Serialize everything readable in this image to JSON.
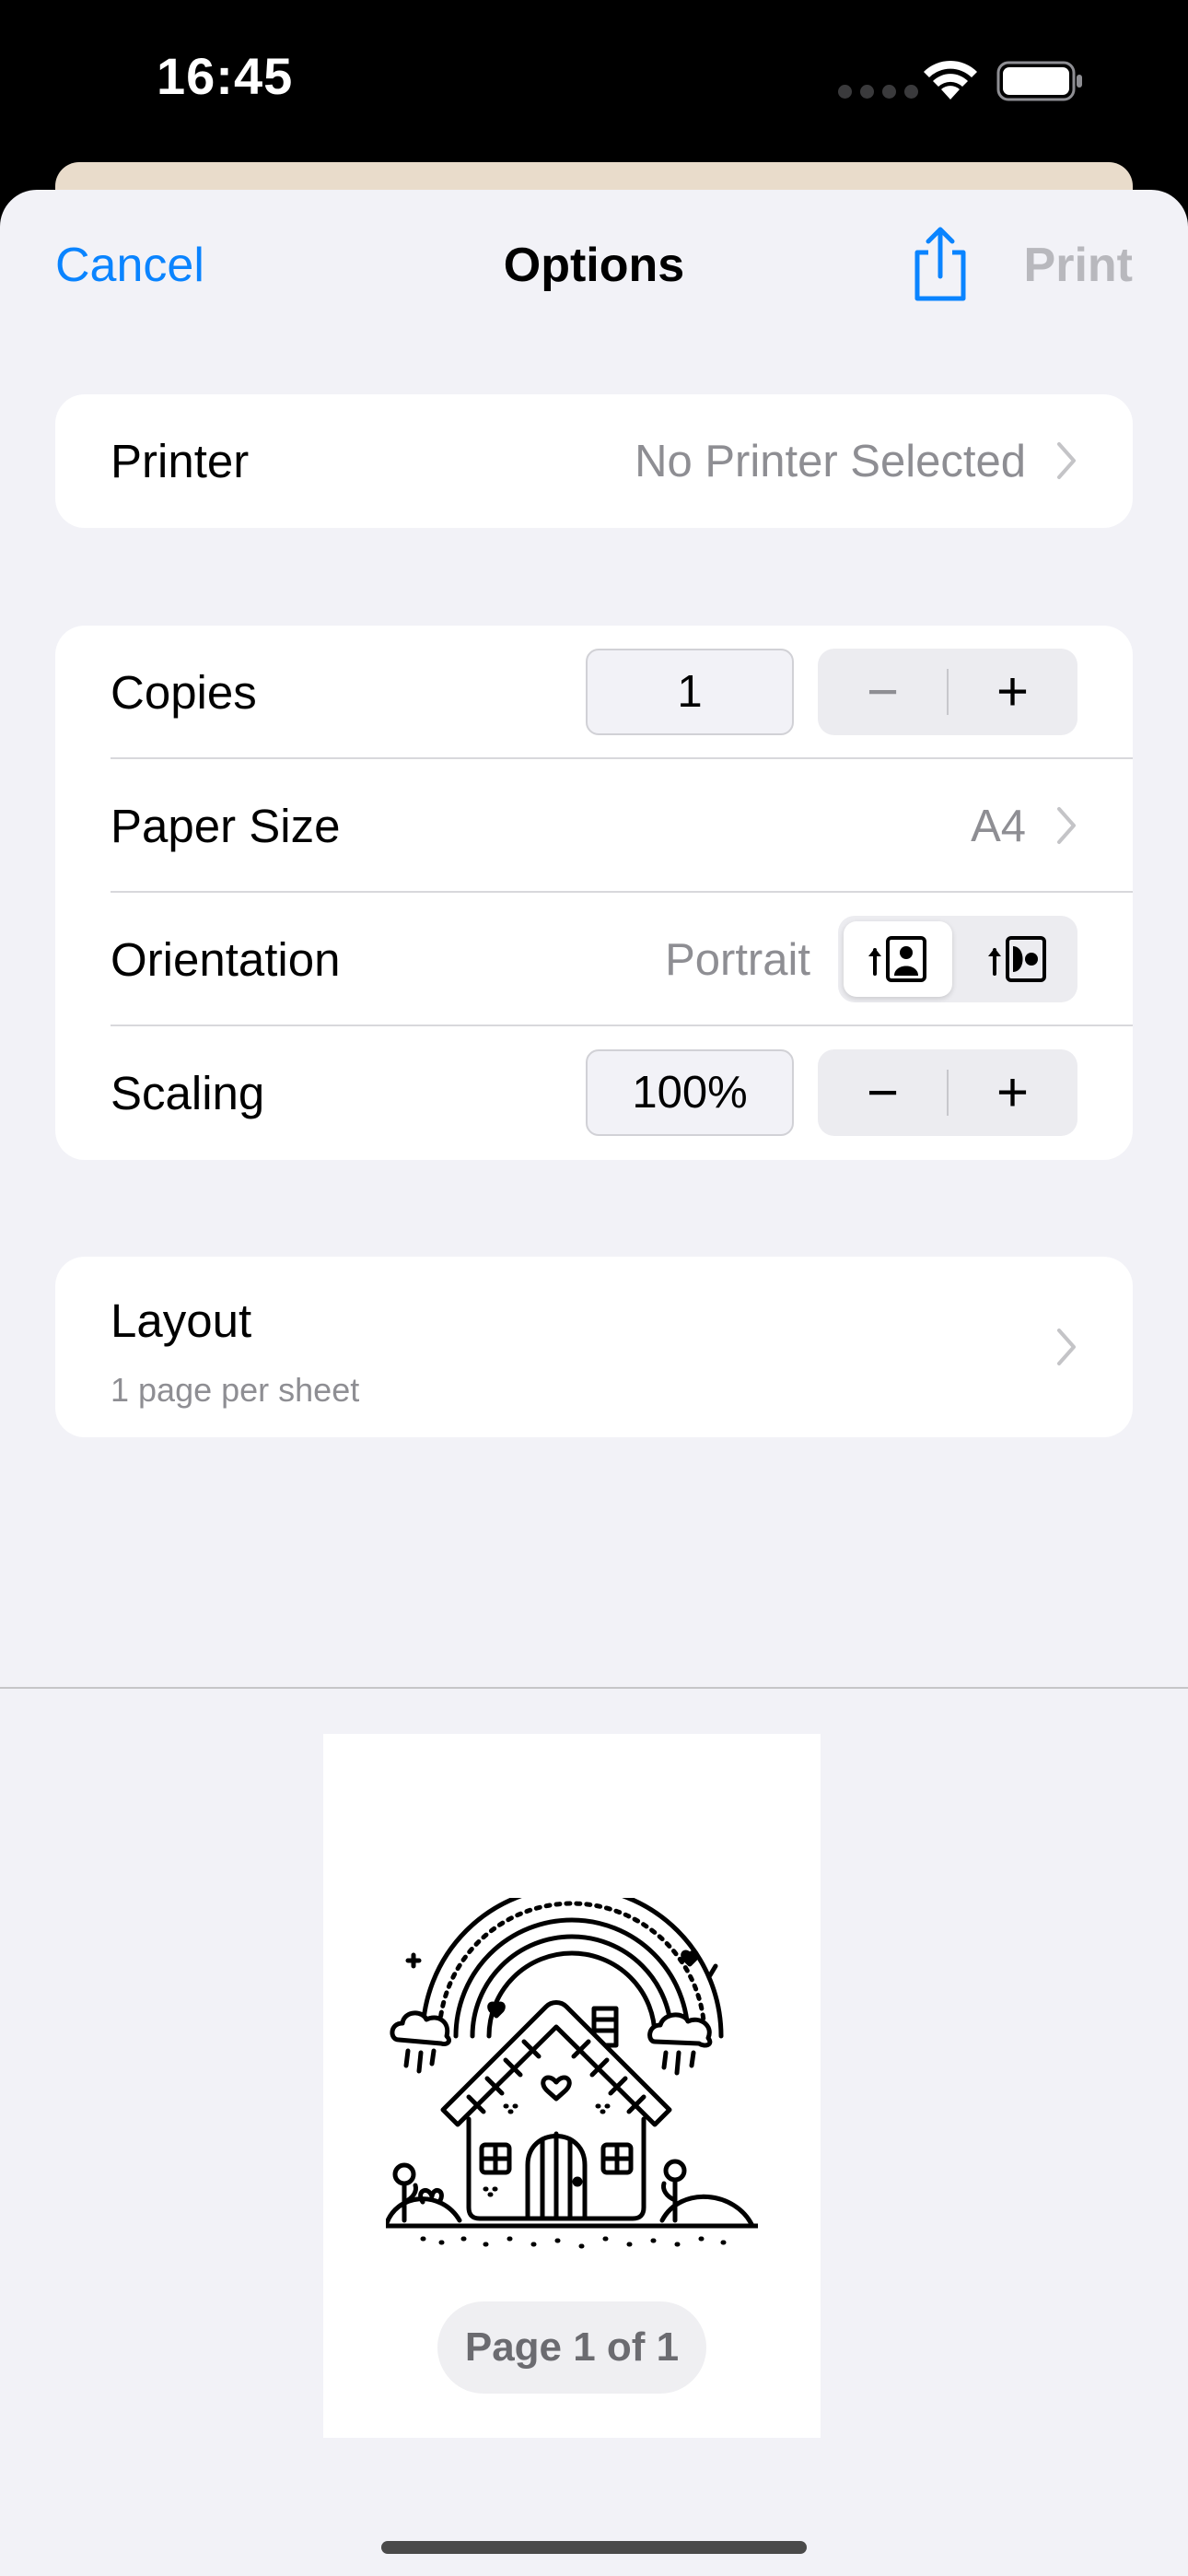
{
  "status_bar": {
    "time": "16:45"
  },
  "nav": {
    "cancel_label": "Cancel",
    "title": "Options",
    "print_label": "Print",
    "share_icon": "share-icon"
  },
  "printer": {
    "label": "Printer",
    "value": "No Printer Selected"
  },
  "copies": {
    "label": "Copies",
    "value": "1",
    "minus": "−",
    "plus": "+"
  },
  "paper_size": {
    "label": "Paper Size",
    "value": "A4"
  },
  "orientation": {
    "label": "Orientation",
    "value": "Portrait",
    "options": [
      "portrait-icon",
      "landscape-icon"
    ],
    "selected": "portrait"
  },
  "scaling": {
    "label": "Scaling",
    "value": "100%",
    "minus": "−",
    "plus": "+"
  },
  "layout": {
    "label": "Layout",
    "subtitle": "1 page per sheet"
  },
  "preview": {
    "page_label": "Page 1 of 1"
  },
  "colors": {
    "accent": "#0a84ff",
    "background": "#f2f2f7",
    "disabled": "#b8b8bd",
    "secondary_text": "#8e8e93"
  }
}
